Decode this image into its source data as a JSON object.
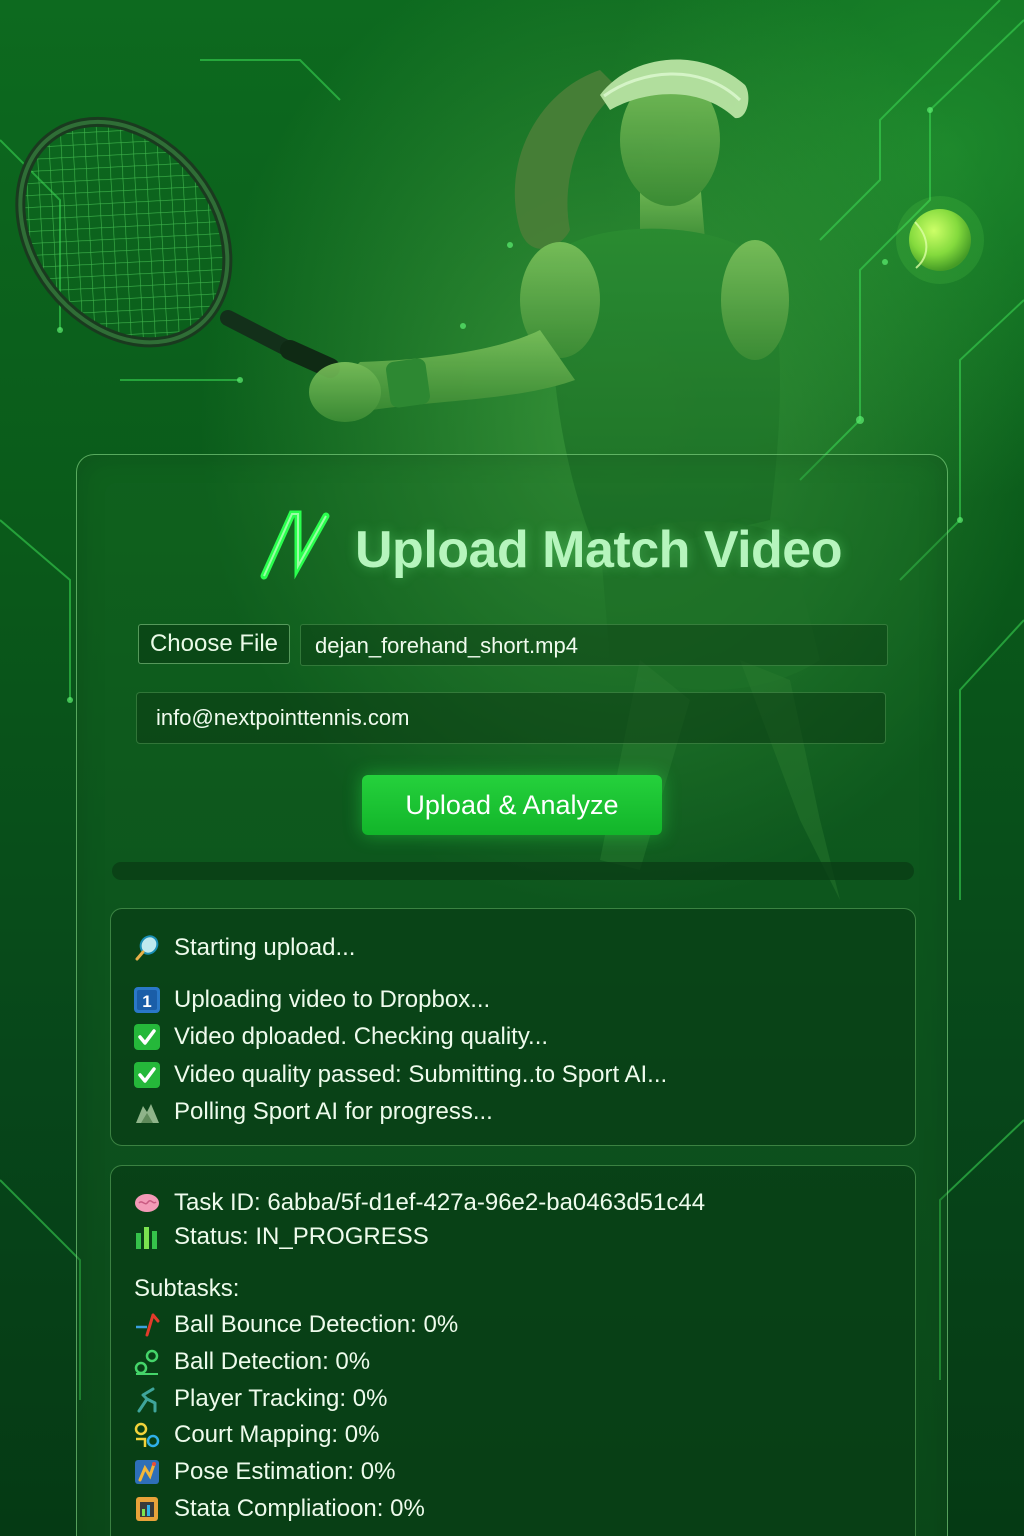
{
  "header": {
    "title": "Upload Match Video"
  },
  "form": {
    "file_button_label": "Choose File",
    "file_name": "dejan_forehand_short.mp4",
    "email_value": "info@nextpointtennis.com",
    "submit_label": "Upload & Analyze",
    "progress": 0
  },
  "log": [
    {
      "icon": "tennis-racket-icon",
      "text": "Starting upload..."
    },
    {
      "icon": "keycap-one-icon",
      "text": "Uploading video to Dropbox..."
    },
    {
      "icon": "check-mark-icon",
      "text": "Video dploaded. Checking quality..."
    },
    {
      "icon": "check-mark-icon",
      "text": "Video quality passed: Submitting..to Sport AI..."
    },
    {
      "icon": "hourglass-icon",
      "text": "Polling Sport AI for progress..."
    }
  ],
  "task": {
    "id_line": "Task ID: 6abba/5f-d1ef-427a-96e2-ba0463d51c44",
    "status_line": "Status: IN_PROGRESS",
    "subtasks_heading": "Subtasks:",
    "subtasks": [
      {
        "icon": "bounce-icon",
        "text": "Ball Bounce Detection: 0%"
      },
      {
        "icon": "ball-detection-icon",
        "text": "Ball Detection: 0%"
      },
      {
        "icon": "player-tracking-icon",
        "text": "Player Tracking: 0%"
      },
      {
        "icon": "court-mapping-icon",
        "text": "Court Mapping: 0%"
      },
      {
        "icon": "pose-estimation-icon",
        "text": "Pose Estimation: 0%"
      },
      {
        "icon": "stats-icon",
        "text": "Stata Compliatioon: 0%"
      }
    ]
  },
  "colors": {
    "accent": "#1fc435",
    "title": "#b6f5bd",
    "text": "#eefbec"
  }
}
